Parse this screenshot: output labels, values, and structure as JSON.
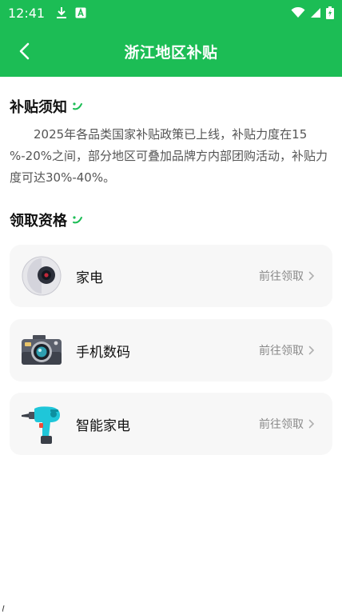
{
  "status_bar": {
    "time": "12:41",
    "left_icons": [
      "download-icon",
      "a-badge-icon"
    ],
    "right_icons": [
      "wifi-icon",
      "signal-icon",
      "battery-charging-icon"
    ]
  },
  "app_bar": {
    "title": "浙江地区补贴",
    "back_icon": "chevron-left-icon",
    "background": "#1cbd55"
  },
  "notice": {
    "title": "补贴须知",
    "text": "2025年各品类国家补贴政策已上线，补贴力度在15 %-20%之间，部分地区可叠加品牌方内部团购活动，补贴力度可达30%-40%。"
  },
  "eligibility": {
    "title": "领取资格",
    "items": [
      {
        "label": "家电",
        "action": "前往领取",
        "icon": "speaker-icon"
      },
      {
        "label": "手机数码",
        "action": "前往领取",
        "icon": "camera-icon"
      },
      {
        "label": "智能家电",
        "action": "前往领取",
        "icon": "drill-icon"
      }
    ]
  },
  "colors": {
    "accent": "#1cbd55",
    "card_bg": "#f7f7f7",
    "muted_text": "#8a8a8a"
  }
}
